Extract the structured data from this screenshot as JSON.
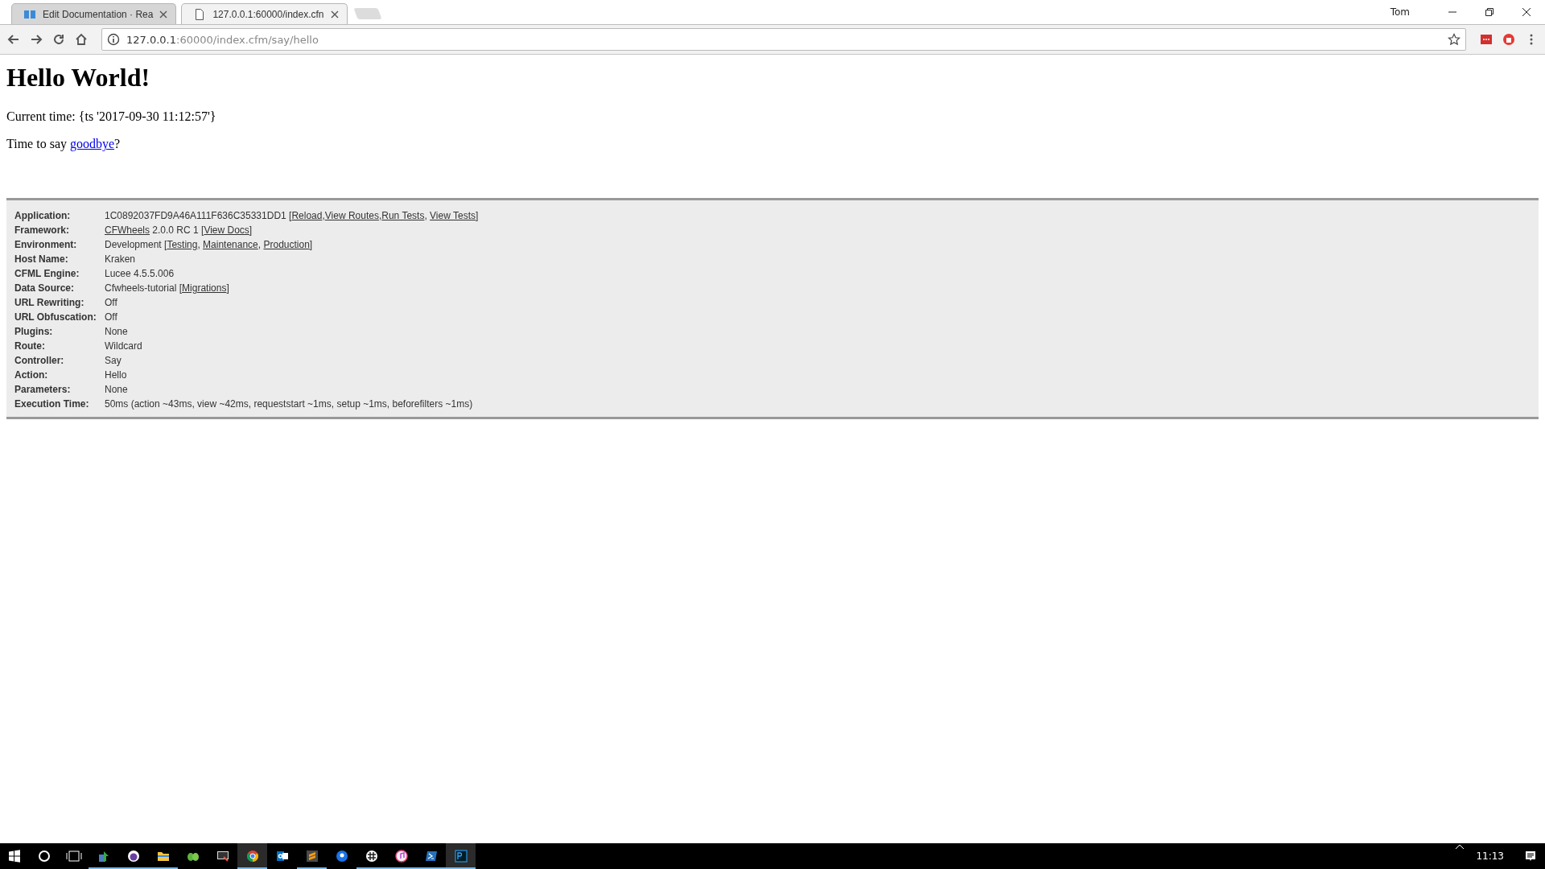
{
  "browser": {
    "tabs": [
      {
        "title": "Edit Documentation · Rea",
        "selected": false,
        "kind": "book"
      },
      {
        "title": "127.0.0.1:60000/index.cfn",
        "selected": true,
        "kind": "page"
      }
    ],
    "user": "Tom",
    "address": {
      "host": "127.0.0.1",
      "rest": ":60000/index.cfm/say/hello"
    }
  },
  "page": {
    "heading": "Hello World!",
    "paragraphs": [
      [
        {
          "kind": "text",
          "text": "Current time: {ts '2017-09-30 11:12:57'}"
        }
      ],
      [
        {
          "kind": "text",
          "text": "Time to say "
        },
        {
          "kind": "link",
          "text": "goodbye"
        },
        {
          "kind": "text",
          "text": "?"
        }
      ]
    ]
  },
  "debug": {
    "rows": [
      {
        "label": "Application:",
        "value": [
          {
            "kind": "text",
            "text": "1C0892037FD9A46A111F636C35331DD1 ["
          },
          {
            "kind": "link",
            "text": "Reload"
          },
          {
            "kind": "text",
            "text": ","
          },
          {
            "kind": "link",
            "text": "View Routes"
          },
          {
            "kind": "text",
            "text": ","
          },
          {
            "kind": "link",
            "text": "Run Tests"
          },
          {
            "kind": "text",
            "text": ", "
          },
          {
            "kind": "link",
            "text": "View Tests"
          },
          {
            "kind": "text",
            "text": "]"
          }
        ]
      },
      {
        "label": "Framework:",
        "value": [
          {
            "kind": "link",
            "text": "CFWheels"
          },
          {
            "kind": "text",
            "text": " 2.0.0 RC 1 ["
          },
          {
            "kind": "link",
            "text": "View Docs"
          },
          {
            "kind": "text",
            "text": "]"
          }
        ]
      },
      {
        "label": "Environment:",
        "value": [
          {
            "kind": "text",
            "text": "Development ["
          },
          {
            "kind": "link",
            "text": "Testing"
          },
          {
            "kind": "text",
            "text": ", "
          },
          {
            "kind": "link",
            "text": "Maintenance"
          },
          {
            "kind": "text",
            "text": ", "
          },
          {
            "kind": "link",
            "text": "Production"
          },
          {
            "kind": "text",
            "text": "]"
          }
        ]
      },
      {
        "label": "Host Name:",
        "value": [
          {
            "kind": "text",
            "text": "Kraken"
          }
        ]
      },
      {
        "label": "CFML Engine:",
        "value": [
          {
            "kind": "text",
            "text": "Lucee 4.5.5.006"
          }
        ]
      },
      {
        "label": "Data Source:",
        "value": [
          {
            "kind": "text",
            "text": "Cfwheels-tutorial ["
          },
          {
            "kind": "link",
            "text": "Migrations"
          },
          {
            "kind": "text",
            "text": "]"
          }
        ]
      },
      {
        "label": "URL Rewriting:",
        "value": [
          {
            "kind": "text",
            "text": "Off"
          }
        ]
      },
      {
        "label": "URL Obfuscation:",
        "value": [
          {
            "kind": "text",
            "text": "Off"
          }
        ]
      },
      {
        "label": "Plugins:",
        "value": [
          {
            "kind": "text",
            "text": "None"
          }
        ]
      },
      {
        "label": "Route:",
        "value": [
          {
            "kind": "text",
            "text": "Wildcard"
          }
        ]
      },
      {
        "label": "Controller:",
        "value": [
          {
            "kind": "text",
            "text": "Say"
          }
        ]
      },
      {
        "label": "Action:",
        "value": [
          {
            "kind": "text",
            "text": "Hello"
          }
        ]
      },
      {
        "label": "Parameters:",
        "value": [
          {
            "kind": "text",
            "text": "None"
          }
        ]
      },
      {
        "label": "Execution Time:",
        "value": [
          {
            "kind": "text",
            "text": "50ms (action ~43ms, view ~42ms, requeststart ~1ms, setup ~1ms, beforefilters ~1ms)"
          }
        ]
      }
    ]
  },
  "taskbar": {
    "apps": [
      {
        "kind": "network",
        "open": true,
        "active": false
      },
      {
        "kind": "purple",
        "open": true,
        "active": false
      },
      {
        "kind": "folder",
        "open": true,
        "active": false
      },
      {
        "kind": "green",
        "open": false,
        "active": false
      },
      {
        "kind": "monitor",
        "open": false,
        "active": false
      },
      {
        "kind": "chrome",
        "open": true,
        "active": true
      },
      {
        "kind": "outlook",
        "open": false,
        "active": false
      },
      {
        "kind": "sublime",
        "open": true,
        "active": false
      },
      {
        "kind": "pin",
        "open": false,
        "active": false
      },
      {
        "kind": "slack",
        "open": true,
        "active": false
      },
      {
        "kind": "itunes",
        "open": true,
        "active": false
      },
      {
        "kind": "powershell",
        "open": true,
        "active": false
      },
      {
        "kind": "ps",
        "open": true,
        "active": true
      }
    ],
    "clock": "11:13"
  }
}
